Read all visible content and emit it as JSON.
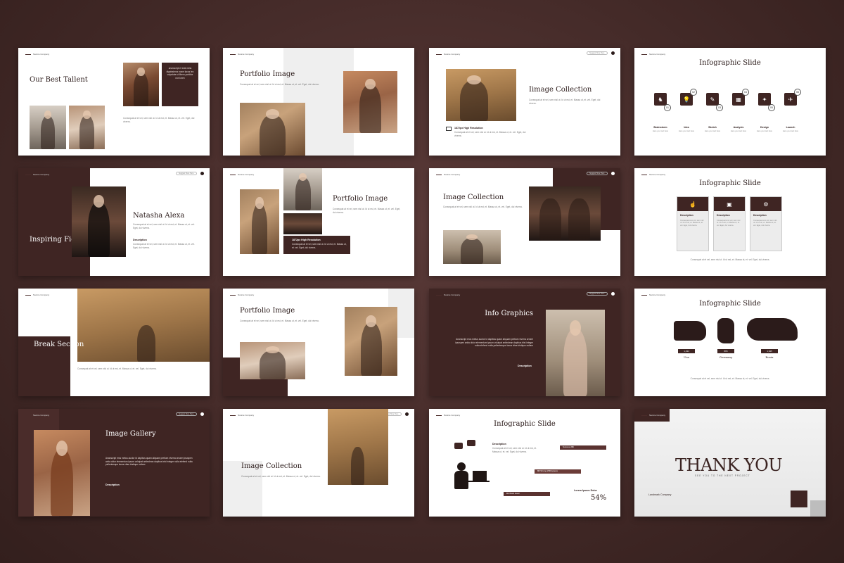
{
  "brand": "Nannie Company",
  "search_placeholder": "Suggest Here Here",
  "lorem": "Consequat at et vel, sem nisl ut. Id ut est, et. Massa ut, et. vel. Eget, dui viverra.",
  "lorem_long": "Ananscript eros metus auctor id dapibus quam aliquam pretium viverra ornare ipsuspen anita dolor elementum ipsum volutpat antieclean dapibus trist integer nulla elefend nulla pellentesque lacus vitae tristique nullam",
  "s1": {
    "title": "Our Best Tallent",
    "box": "ananscript et erat meta dignissimos nosm lacus leo vulputate ut libero porttitor non loren"
  },
  "s2": {
    "title": "Portfolio Image"
  },
  "s3": {
    "title": "Iimage Collection",
    "res": "1872px High Resolution"
  },
  "s4": {
    "title": "Infographic Slide",
    "steps": [
      {
        "n": "01",
        "label": "Brainstorm",
        "icon": "♞"
      },
      {
        "n": "02",
        "label": "Idea",
        "icon": "💡"
      },
      {
        "n": "03",
        "label": "Sketch",
        "icon": "✎"
      },
      {
        "n": "04",
        "label": "Analysis",
        "icon": "▦"
      },
      {
        "n": "05",
        "label": "Design",
        "icon": "✦"
      },
      {
        "n": "06",
        "label": "Launch",
        "icon": "✈"
      }
    ],
    "step_sub": "Here your text here"
  },
  "s5": {
    "side": "Inspiring Figure",
    "name": "Natasha Alexa",
    "desc": "Description"
  },
  "s6": {
    "title": "Portfolio Image",
    "res": "1872px High Resolution"
  },
  "s7": {
    "title": "Image Collection"
  },
  "s8": {
    "title": "Infographic Slide",
    "desc": "Description",
    "icons": [
      "☝",
      "▣",
      "⚙"
    ]
  },
  "s9": {
    "title": "Break Section"
  },
  "s10": {
    "title": "Portfolio Image"
  },
  "s11": {
    "title": "Info Graphics",
    "desc": "Description"
  },
  "s12": {
    "title": "Infographic Slide",
    "countries": [
      {
        "name": "Usa",
        "value": "1,234"
      },
      {
        "name": "Germany",
        "value": "865"
      },
      {
        "name": "Rosia",
        "value": "1,945"
      }
    ]
  },
  "s13": {
    "title": "Image Gallery",
    "desc": "Description"
  },
  "s14": {
    "title": "Image Collection"
  },
  "s15": {
    "title": "Infographic Slide",
    "desc": "Description",
    "steps": [
      {
        "n": "03",
        "label": "Success"
      },
      {
        "n": "02",
        "label": "Strong Willingness"
      },
      {
        "n": "01",
        "label": "Work Hard"
      }
    ],
    "label_caption": "Lorem Ipsum Dolor",
    "percent": "54%"
  },
  "s16": {
    "title": "THANK YOU",
    "sub": "SEE YOU TO THE NEXT PROJECT",
    "foot": "Landmark Company"
  }
}
